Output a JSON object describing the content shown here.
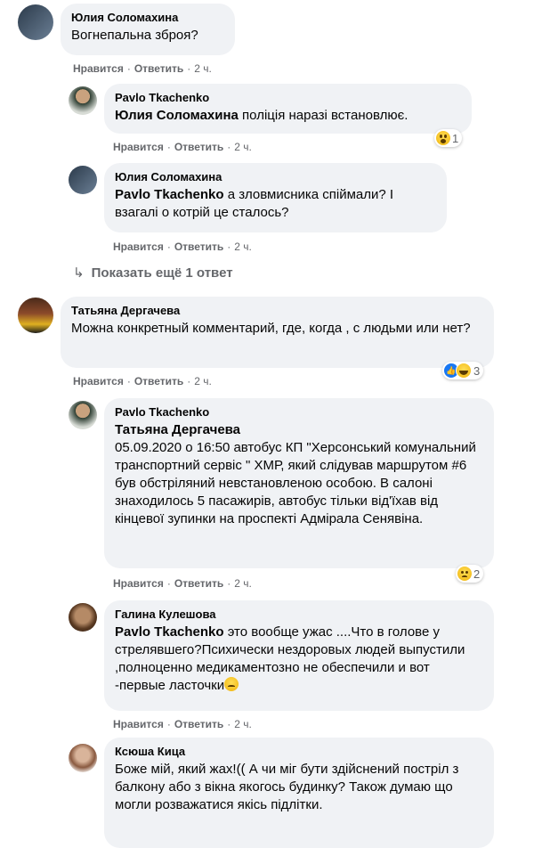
{
  "labels": {
    "like": "Нравится",
    "reply": "Ответить",
    "sep": "·"
  },
  "comments": [
    {
      "author": "Юлия Соломахина",
      "text": "Вогнепальна зброя?",
      "time": "2 ч."
    },
    {
      "author": "Pavlo Tkachenko",
      "mention": "Юлия Соломахина",
      "text": " поліція наразі встановлює.",
      "time": "2 ч.",
      "reaction_count": "1"
    },
    {
      "author": "Юлия Соломахина",
      "mention": "Pavlo Tkachenko",
      "text": " а зловмисника спіймали? І взагалі о котрій це сталось?",
      "time": "2 ч."
    },
    {
      "more_replies": "Показать ещё 1 ответ"
    },
    {
      "author": "Татьяна Дергачева",
      "text": "Можна конкретный комментарий, где, когда , с людьми или нет?",
      "time": "2 ч.",
      "reaction_count": "3"
    },
    {
      "author": "Pavlo Tkachenko",
      "mention": "Татьяна Дергачева",
      "text": "05.09.2020 о 16:50 автобус КП \"Херсонський комунальний транспортний сервіс \" ХМР, який слідував маршрутом #6 був обстріляний невстановленою особою. В салоні знаходилось 5 пасажирів, автобус тільки від'їхав від кінцевої зупинки на проспекті Адмірала Сенявіна.",
      "time": "2 ч.",
      "reaction_count": "2"
    },
    {
      "author": "Галина Кулешова",
      "mention": "Pavlo Tkachenko",
      "text": " это вообще ужас ....Что в голове у стрелявшего?Психически нездоровых людей выпустили ,полноценно медикаментозно не обеспечили и вот -первые ласточки",
      "time": "2 ч."
    },
    {
      "author": "Ксюша Кица",
      "text": "Боже мій, який жах!(( А чи міг бути здійснений постріл з балкону або з вікна якогось будинку? Також думаю що могли розважатися якісь підлітки.",
      "time": ""
    }
  ],
  "colors": {
    "bubble": "#f0f2f5",
    "meta": "#65676b",
    "text": "#050505",
    "like_blue": "#1877f2"
  }
}
